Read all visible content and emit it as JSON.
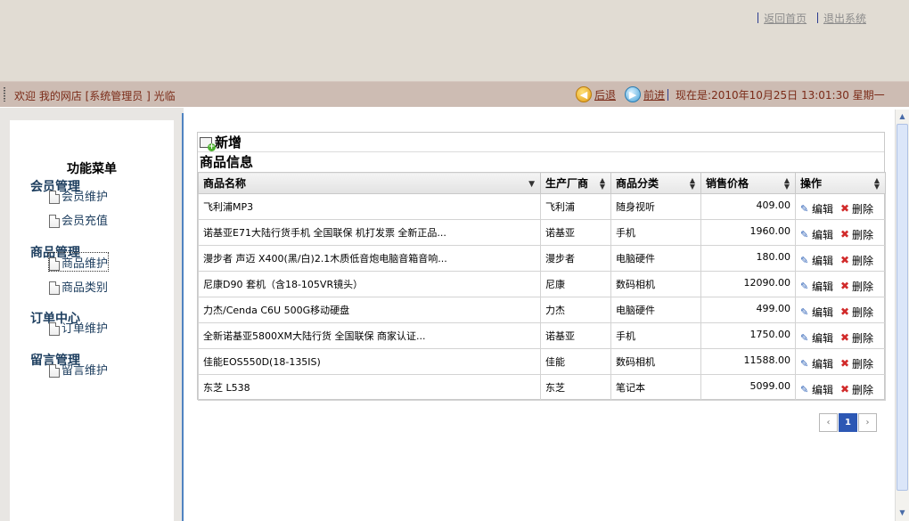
{
  "header": {
    "links": [
      "返回首页",
      "退出系统"
    ]
  },
  "topbar": {
    "welcome": "欢迎 我的网店 [系统管理员 ] 光临",
    "back_label": "后退",
    "forward_label": "前进",
    "datetime": "现在是:2010年10月25日 13:01:30 星期一"
  },
  "sidebar": {
    "title": "功能菜单",
    "groups": [
      {
        "label": "会员管理",
        "items": [
          "会员维护",
          "会员充值"
        ]
      },
      {
        "label": "商品管理",
        "items": [
          "商品维护",
          "商品类别"
        ]
      },
      {
        "label": "订单中心",
        "items": [
          "订单维护"
        ]
      },
      {
        "label": "留言管理",
        "items": [
          "留言维护"
        ]
      }
    ],
    "active_item": "商品维护"
  },
  "main": {
    "add_label": "新增",
    "caption": "商品信息",
    "columns": [
      "商品名称",
      "生产厂商",
      "商品分类",
      "销售价格",
      "操作"
    ],
    "rows": [
      {
        "name": "飞利浦MP3",
        "maker": "飞利浦",
        "category": "随身视听",
        "price": "409.00"
      },
      {
        "name": "诺基亚E71大陆行货手机 全国联保 机打发票 全新正品...",
        "maker": "诺基亚",
        "category": "手机",
        "price": "1960.00"
      },
      {
        "name": "漫步者 声迈 X400(黑/白)2.1木质低音炮电脑音箱音响...",
        "maker": "漫步者",
        "category": "电脑硬件",
        "price": "180.00"
      },
      {
        "name": "尼康D90 套机（含18-105VR镜头）",
        "maker": "尼康",
        "category": "数码相机",
        "price": "12090.00"
      },
      {
        "name": "力杰/Cenda C6U 500G移动硬盘",
        "maker": "力杰",
        "category": "电脑硬件",
        "price": "499.00"
      },
      {
        "name": "全新诺基亚5800XM大陆行货 全国联保 商家认证...",
        "maker": "诺基亚",
        "category": "手机",
        "price": "1750.00"
      },
      {
        "name": "佳能EOS550D(18-135IS)",
        "maker": "佳能",
        "category": "数码相机",
        "price": "11588.00"
      },
      {
        "name": "东芝 L538",
        "maker": "东芝",
        "category": "笔记本",
        "price": "5099.00"
      }
    ],
    "edit_label": "编辑",
    "delete_label": "删除"
  },
  "pager": {
    "prev": "‹",
    "current": "1",
    "next": "›"
  },
  "icons": {
    "back": "arrow-left-icon",
    "forward": "arrow-right-icon",
    "doc": "document-icon",
    "edit": "pencil-icon",
    "delete": "x-icon"
  },
  "colors": {
    "header_bg": "#e1dcd3",
    "bar_bg": "#cdbcb3",
    "bar_text": "#7a2a17",
    "menu_text": "#1c3d5e",
    "pager_active": "#2d58b4"
  }
}
